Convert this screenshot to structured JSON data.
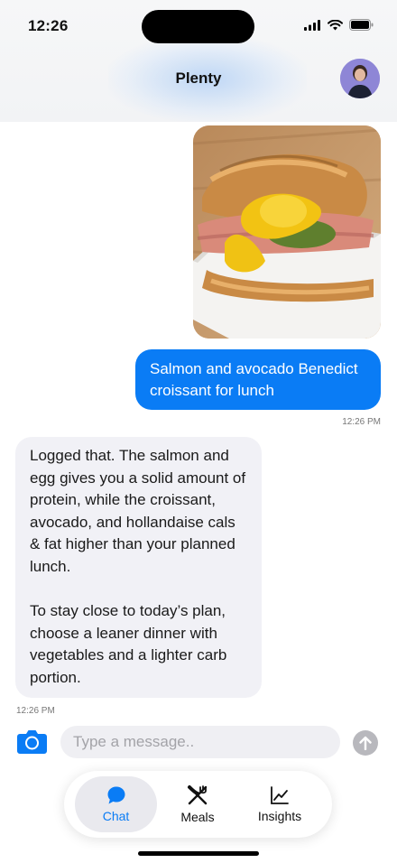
{
  "status_bar": {
    "time": "12:26"
  },
  "header": {
    "title": "Plenty"
  },
  "messages": [
    {
      "from": "user",
      "type": "image",
      "alt": ""
    },
    {
      "from": "user",
      "type": "text",
      "text": "Salmon and avocado Benedict croissant for lunch",
      "time": "12:26 PM"
    },
    {
      "from": "assistant",
      "type": "text",
      "text": "Logged that. The salmon and egg gives you a solid amount of protein, while the croissant, avocado, and hollandaise cals & fat higher than your planned lunch.\n\nTo stay close to today’s plan, choose a leaner dinner with vegetables and a lighter carb portion.",
      "time": "12:26 PM"
    }
  ],
  "composer": {
    "placeholder": "Type a message.."
  },
  "tabs": [
    {
      "label": "Chat",
      "icon": "chat-bubble-icon",
      "active": true
    },
    {
      "label": "Meals",
      "icon": "fork-knife-icon",
      "active": false
    },
    {
      "label": "Insights",
      "icon": "line-chart-icon",
      "active": false
    }
  ],
  "colors": {
    "accent": "#0a7cf5",
    "assistant_bubble": "#f1f1f6",
    "input_bg": "#efeff3"
  }
}
